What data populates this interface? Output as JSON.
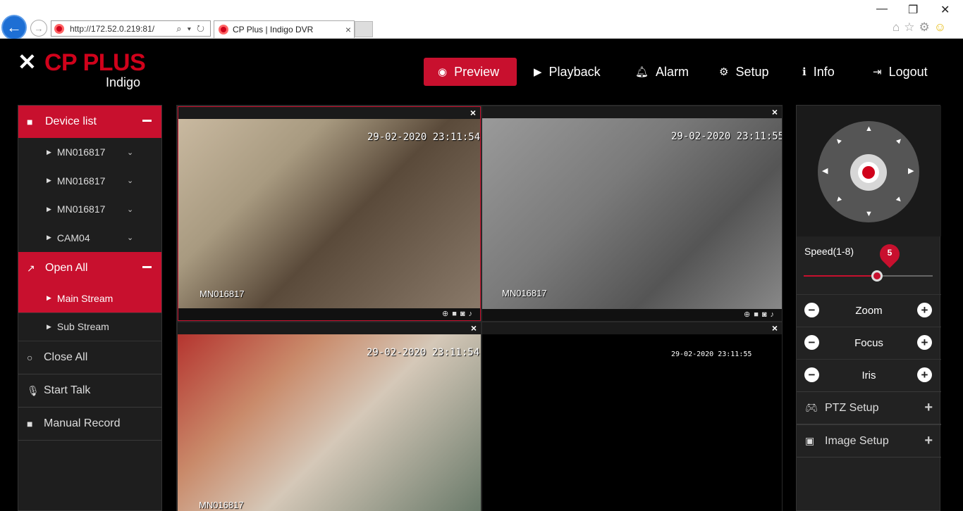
{
  "browser": {
    "url": "http://172.52.0.219:81/",
    "tab_title": "CP Plus | Indigo DVR",
    "tab_close": "×",
    "minimize": "—",
    "restore": "❐",
    "close": "✕"
  },
  "logo": {
    "brand": "CP PLUS",
    "sub": "Indigo"
  },
  "topnav": [
    {
      "label": "Preview",
      "icon": "eye-icon",
      "active": true
    },
    {
      "label": "Playback",
      "icon": "play-circle-icon"
    },
    {
      "label": "Alarm",
      "icon": "bell-icon"
    },
    {
      "label": "Setup",
      "icon": "gear-icon"
    },
    {
      "label": "Info",
      "icon": "info-icon"
    },
    {
      "label": "Logout",
      "icon": "logout-icon"
    }
  ],
  "left_panel": {
    "device_list": "Device list",
    "devices": [
      "MN016817",
      "MN016817",
      "MN016817",
      "CAM04"
    ],
    "open_all": "Open All",
    "streams": [
      {
        "label": "Main Stream",
        "active": true
      },
      {
        "label": "Sub Stream",
        "active": false
      }
    ],
    "close_all": "Close All",
    "start_talk": "Start Talk",
    "manual_record": "Manual Record"
  },
  "tiles": [
    {
      "timestamp": "29-02-2020 23:11:54",
      "camera": "MN016817"
    },
    {
      "timestamp": "29-02-2020 23:11:55",
      "camera": "MN016817"
    },
    {
      "timestamp": "29-02-2020 23:11:54",
      "camera": "MN016817"
    },
    {
      "timestamp": "29-02-2020 23:11:55",
      "camera": ""
    }
  ],
  "ptz": {
    "speed_label": "Speed(1-8)",
    "speed_value": "5",
    "speed_fraction": 0.571,
    "controls": [
      "Zoom",
      "Focus",
      "Iris"
    ],
    "ptz_setup": "PTZ Setup",
    "image_setup": "Image Setup"
  },
  "colors": {
    "accent": "#c8102e",
    "background": "#000000",
    "panel": "#1e1e1e"
  }
}
